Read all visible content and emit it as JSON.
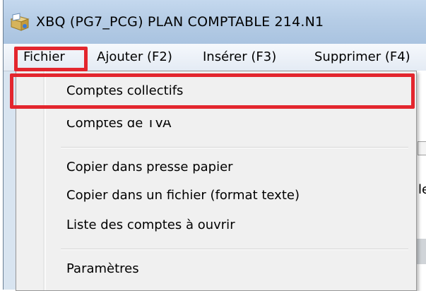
{
  "window": {
    "title": "XBQ  (PG7_PCG) PLAN COMPTABLE 214.N1",
    "icon": "app-folder-icon"
  },
  "menubar": {
    "items": [
      {
        "label": "Fichier"
      },
      {
        "label": "Ajouter (F2)"
      },
      {
        "label": "Insérer (F3)"
      },
      {
        "label": "Supprimer (F4)"
      }
    ]
  },
  "dropdown": {
    "items": [
      {
        "label": "Comptes collectifs"
      },
      {
        "label": "Comptes de TVA"
      },
      {
        "label": "Copier dans presse papier"
      },
      {
        "label": "Copier dans un fichier (format texte)"
      },
      {
        "label": "Liste des comptes à ouvrir"
      },
      {
        "label": "Paramètres"
      }
    ]
  },
  "background": {
    "partial_letter": "le"
  },
  "colors": {
    "highlight": "#e3262e",
    "menu_bg": "#f0f0f0",
    "titlebar": "#b6cde6"
  }
}
